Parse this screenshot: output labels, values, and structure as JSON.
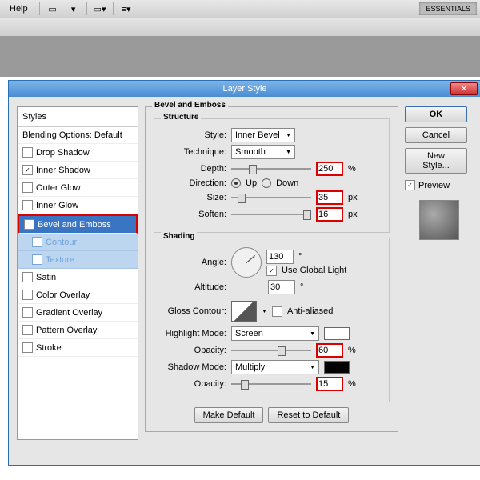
{
  "topbar": {
    "help": "Help",
    "workspace": "ESSENTIALS"
  },
  "dialog": {
    "title": "Layer Style"
  },
  "styles": {
    "header": "Styles",
    "blending": "Blending Options: Default",
    "items": [
      {
        "label": "Drop Shadow",
        "checked": false
      },
      {
        "label": "Inner Shadow",
        "checked": true
      },
      {
        "label": "Outer Glow",
        "checked": false
      },
      {
        "label": "Inner Glow",
        "checked": false
      },
      {
        "label": "Bevel and Emboss",
        "checked": true,
        "selected": true,
        "highlight": true
      },
      {
        "label": "Contour",
        "checked": false,
        "sub": true
      },
      {
        "label": "Texture",
        "checked": false,
        "sub": true
      },
      {
        "label": "Satin",
        "checked": false
      },
      {
        "label": "Color Overlay",
        "checked": false
      },
      {
        "label": "Gradient Overlay",
        "checked": false
      },
      {
        "label": "Pattern Overlay",
        "checked": false
      },
      {
        "label": "Stroke",
        "checked": false
      }
    ]
  },
  "panel": {
    "title": "Bevel and Emboss",
    "structure": {
      "legend": "Structure",
      "style_label": "Style:",
      "style_value": "Inner Bevel",
      "technique_label": "Technique:",
      "technique_value": "Smooth",
      "depth_label": "Depth:",
      "depth_value": "250",
      "depth_unit": "%",
      "direction_label": "Direction:",
      "up": "Up",
      "down": "Down",
      "size_label": "Size:",
      "size_value": "35",
      "size_unit": "px",
      "soften_label": "Soften:",
      "soften_value": "16",
      "soften_unit": "px"
    },
    "shading": {
      "legend": "Shading",
      "angle_label": "Angle:",
      "angle_value": "130",
      "deg": "°",
      "global": "Use Global Light",
      "altitude_label": "Altitude:",
      "altitude_value": "30",
      "gloss_label": "Gloss Contour:",
      "anti": "Anti-aliased",
      "hmode_label": "Highlight Mode:",
      "hmode_value": "Screen",
      "hcolor": "#ffffff",
      "hop_label": "Opacity:",
      "hop_value": "60",
      "hop_unit": "%",
      "smode_label": "Shadow Mode:",
      "smode_value": "Multiply",
      "scolor": "#000000",
      "sop_label": "Opacity:",
      "sop_value": "15",
      "sop_unit": "%"
    },
    "make_default": "Make Default",
    "reset": "Reset to Default"
  },
  "buttons": {
    "ok": "OK",
    "cancel": "Cancel",
    "new_style": "New Style...",
    "preview": "Preview"
  }
}
